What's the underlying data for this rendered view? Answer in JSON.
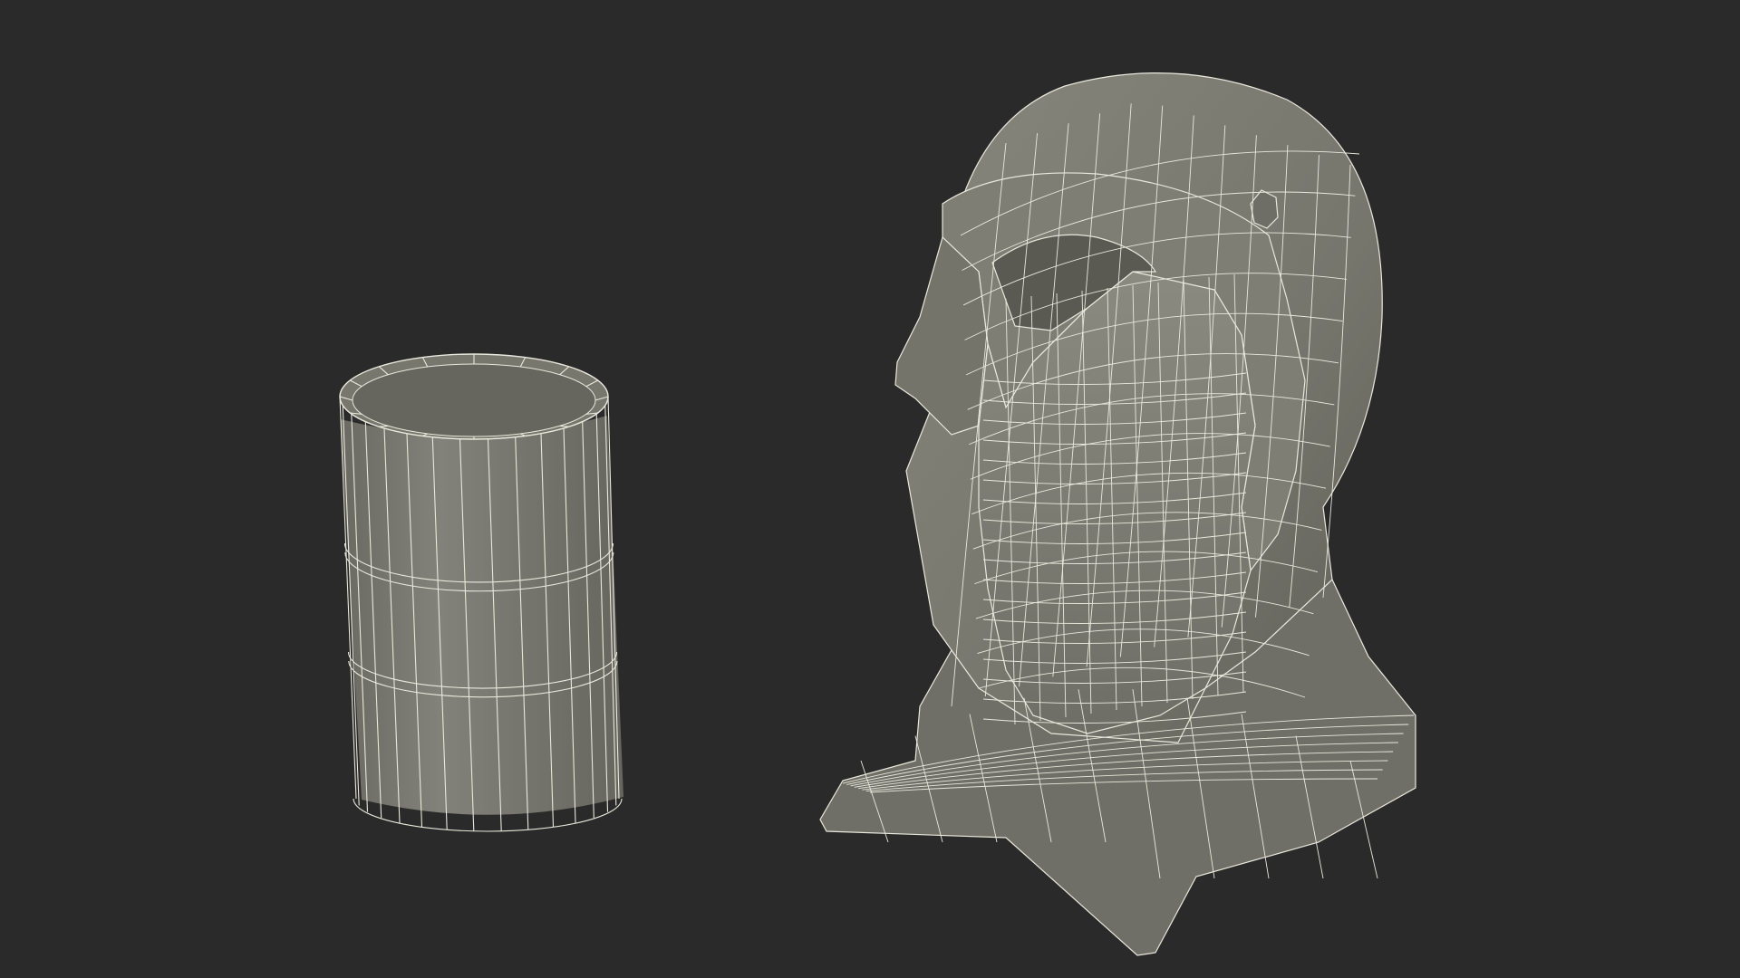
{
  "scene": {
    "background": "#2a2a2a",
    "surface_color": "#7a7a70",
    "surface_shadow": "#5e5e56",
    "interior_color": "#6a6a62",
    "wire_color": "#e8e8dc"
  },
  "objects": [
    {
      "id": "oil-barrel"
    },
    {
      "id": "hooded-head-mask"
    }
  ]
}
